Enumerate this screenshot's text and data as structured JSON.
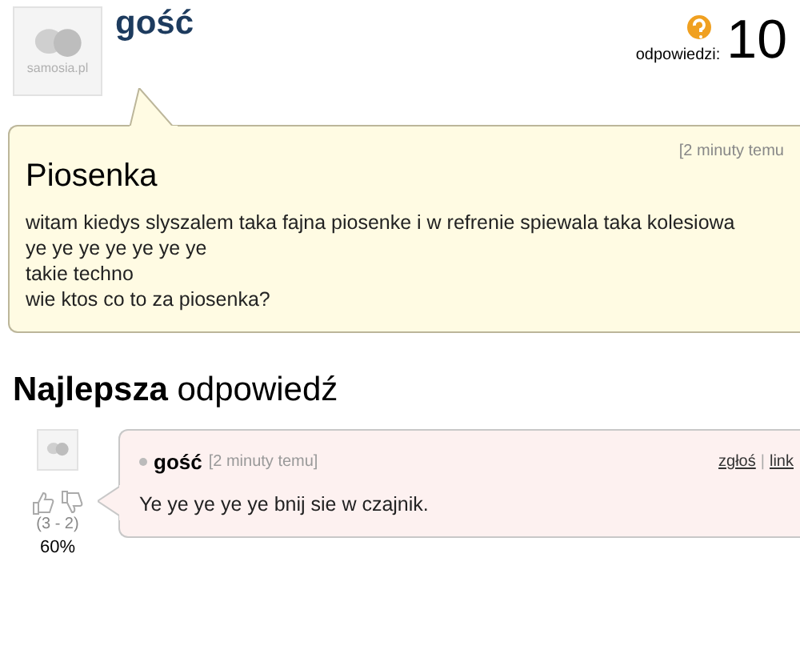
{
  "question": {
    "author": "gość",
    "avatar_label": "samosia.pl",
    "answers_label": "odpowiedzi:",
    "answers_count": "10",
    "time": "[2 minuty temu",
    "title": "Piosenka",
    "body": [
      "witam kiedys slyszalem taka fajna piosenke i w refrenie spiewala taka kolesiowa",
      "ye ye ye ye ye ye ye",
      "takie techno",
      "wie ktos co to za piosenka?"
    ]
  },
  "best_answer": {
    "heading": "**Najlepsza** odpowiedź",
    "author": "gość",
    "time": "[2 minuty temu]",
    "links": [
      "zgłoś",
      "link"
    ],
    "separator": "|",
    "body": "Ye ye ye ye ye bnij sie w czajnik.",
    "votes": "(3 - 2)",
    "percent": "60%"
  }
}
